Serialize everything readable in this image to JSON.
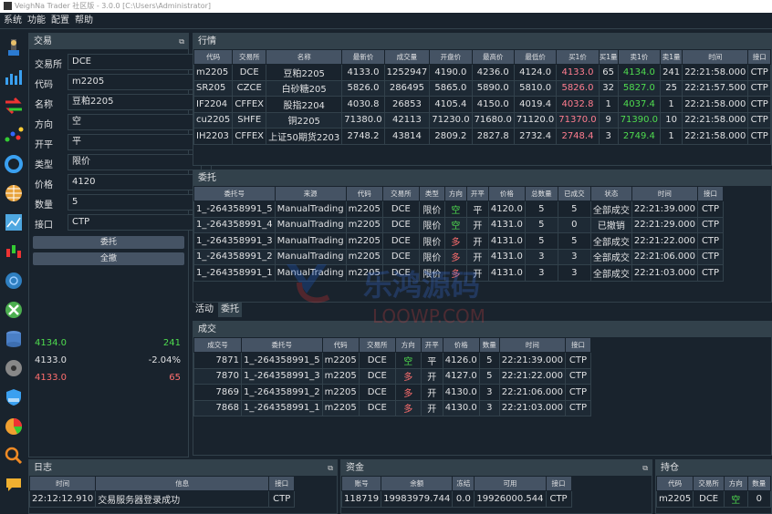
{
  "window": {
    "title": "VeighNa Trader 社区版 - 3.0.0   [C:\\Users\\Administrator]"
  },
  "menu": [
    "系统",
    "功能",
    "配置",
    "帮助"
  ],
  "toolbar_icons": [
    "contract-query-icon",
    "spread-chart-icon",
    "exchange-arrows-icon",
    "scatter-dots-icon",
    "circle-ring-icon",
    "grid-globe-icon",
    "data-map-icon",
    "candlestick-icon",
    "network-icon",
    "cross-tools-icon",
    "database-icon",
    "disk-icon",
    "shield-icon",
    "pie-chart-icon",
    "search-icon",
    "chat-icon"
  ],
  "trade": {
    "title": "交易",
    "exchange_label": "交易所",
    "exchange": "DCE",
    "symbol_label": "代码",
    "symbol": "m2205",
    "name_label": "名称",
    "name": "豆粕2205",
    "direction_label": "方向",
    "direction": "空",
    "offset_label": "开平",
    "offset": "平",
    "type_label": "类型",
    "type": "限价",
    "price_label": "价格",
    "price": "4120",
    "volume_label": "数量",
    "volume": "5",
    "gateway_label": "接口",
    "gateway": "CTP",
    "send_btn": "委托",
    "cancel_all_btn": "全撤",
    "depth": [
      {
        "price": "4134.0",
        "value": "241",
        "color": "green"
      },
      {
        "price": "4133.0",
        "value": "-2.04%",
        "color": "white"
      },
      {
        "price": "4133.0",
        "value": "65",
        "color": "red"
      }
    ]
  },
  "tick": {
    "title": "行情",
    "headers": [
      "代码",
      "交易所",
      "名称",
      "最新价",
      "成交量",
      "开盘价",
      "最高价",
      "最低价",
      "买1价",
      "买1量",
      "卖1价",
      "卖1量",
      "时间",
      "接口"
    ],
    "rows": [
      [
        "m2205",
        "DCE",
        "豆粕2205",
        "4133.0",
        "1252947",
        "4190.0",
        "4236.0",
        "4124.0",
        "4133.0",
        "65",
        "4134.0",
        "241",
        "22:21:58.000",
        "CTP"
      ],
      [
        "SR205",
        "CZCE",
        "白砂糖205",
        "5826.0",
        "286495",
        "5865.0",
        "5890.0",
        "5810.0",
        "5826.0",
        "32",
        "5827.0",
        "25",
        "22:21:57.500",
        "CTP"
      ],
      [
        "IF2204",
        "CFFEX",
        "股指2204",
        "4030.8",
        "26853",
        "4105.4",
        "4150.0",
        "4019.4",
        "4032.8",
        "1",
        "4037.4",
        "1",
        "22:21:58.000",
        "CTP"
      ],
      [
        "cu2205",
        "SHFE",
        "铜2205",
        "71380.0",
        "42113",
        "71230.0",
        "71680.0",
        "71120.0",
        "71370.0",
        "9",
        "71390.0",
        "10",
        "22:21:58.000",
        "CTP"
      ],
      [
        "IH2203",
        "CFFEX",
        "上证50期货2203",
        "2748.2",
        "43814",
        "2809.2",
        "2827.8",
        "2732.4",
        "2748.4",
        "3",
        "2749.4",
        "1",
        "22:21:58.000",
        "CTP"
      ]
    ]
  },
  "order": {
    "title": "委托",
    "headers": [
      "委托号",
      "来源",
      "代码",
      "交易所",
      "类型",
      "方向",
      "开平",
      "价格",
      "总数量",
      "已成交",
      "状态",
      "时间",
      "接口"
    ],
    "rows": [
      [
        "1_-264358991_5",
        "ManualTrading",
        "m2205",
        "DCE",
        "限价",
        "空",
        "平",
        "4120.0",
        "5",
        "5",
        "全部成交",
        "22:21:39.000",
        "CTP"
      ],
      [
        "1_-264358991_4",
        "ManualTrading",
        "m2205",
        "DCE",
        "限价",
        "空",
        "开",
        "4131.0",
        "5",
        "0",
        "已撤销",
        "22:21:29.000",
        "CTP"
      ],
      [
        "1_-264358991_3",
        "ManualTrading",
        "m2205",
        "DCE",
        "限价",
        "多",
        "开",
        "4131.0",
        "5",
        "5",
        "全部成交",
        "22:21:22.000",
        "CTP"
      ],
      [
        "1_-264358991_2",
        "ManualTrading",
        "m2205",
        "DCE",
        "限价",
        "多",
        "开",
        "4131.0",
        "3",
        "3",
        "全部成交",
        "22:21:06.000",
        "CTP"
      ],
      [
        "1_-264358991_1",
        "ManualTrading",
        "m2205",
        "DCE",
        "限价",
        "多",
        "开",
        "4131.0",
        "3",
        "3",
        "全部成交",
        "22:21:03.000",
        "CTP"
      ]
    ],
    "tabs": [
      "活动",
      "委托"
    ]
  },
  "trades": {
    "title": "成交",
    "headers": [
      "成交号",
      "委托号",
      "代码",
      "交易所",
      "方向",
      "开平",
      "价格",
      "数量",
      "时间",
      "接口"
    ],
    "rows": [
      [
        "7871",
        "1_-264358991_5",
        "m2205",
        "DCE",
        "空",
        "平",
        "4126.0",
        "5",
        "22:21:39.000",
        "CTP"
      ],
      [
        "7870",
        "1_-264358991_3",
        "m2205",
        "DCE",
        "多",
        "开",
        "4127.0",
        "5",
        "22:21:22.000",
        "CTP"
      ],
      [
        "7869",
        "1_-264358991_2",
        "m2205",
        "DCE",
        "多",
        "开",
        "4130.0",
        "3",
        "22:21:06.000",
        "CTP"
      ],
      [
        "7868",
        "1_-264358991_1",
        "m2205",
        "DCE",
        "多",
        "开",
        "4130.0",
        "3",
        "22:21:03.000",
        "CTP"
      ]
    ]
  },
  "log": {
    "title": "日志",
    "headers": [
      "时间",
      "信息",
      "接口"
    ],
    "rows": [
      [
        "22:12:12.910",
        "交易服务器登录成功",
        "CTP"
      ]
    ]
  },
  "account": {
    "title": "资金",
    "headers": [
      "账号",
      "余额",
      "冻结",
      "可用",
      "接口"
    ],
    "rows": [
      [
        "118719",
        "19983979.744",
        "0.0",
        "19926000.544",
        "CTP"
      ]
    ]
  },
  "position": {
    "title": "持仓",
    "headers": [
      "代码",
      "交易所",
      "方向",
      "数量"
    ],
    "rows": [
      [
        "m2205",
        "DCE",
        "空",
        "0"
      ]
    ]
  },
  "watermark": {
    "text1": "乐鸿源码",
    "text2": "LOOWP.COM"
  }
}
